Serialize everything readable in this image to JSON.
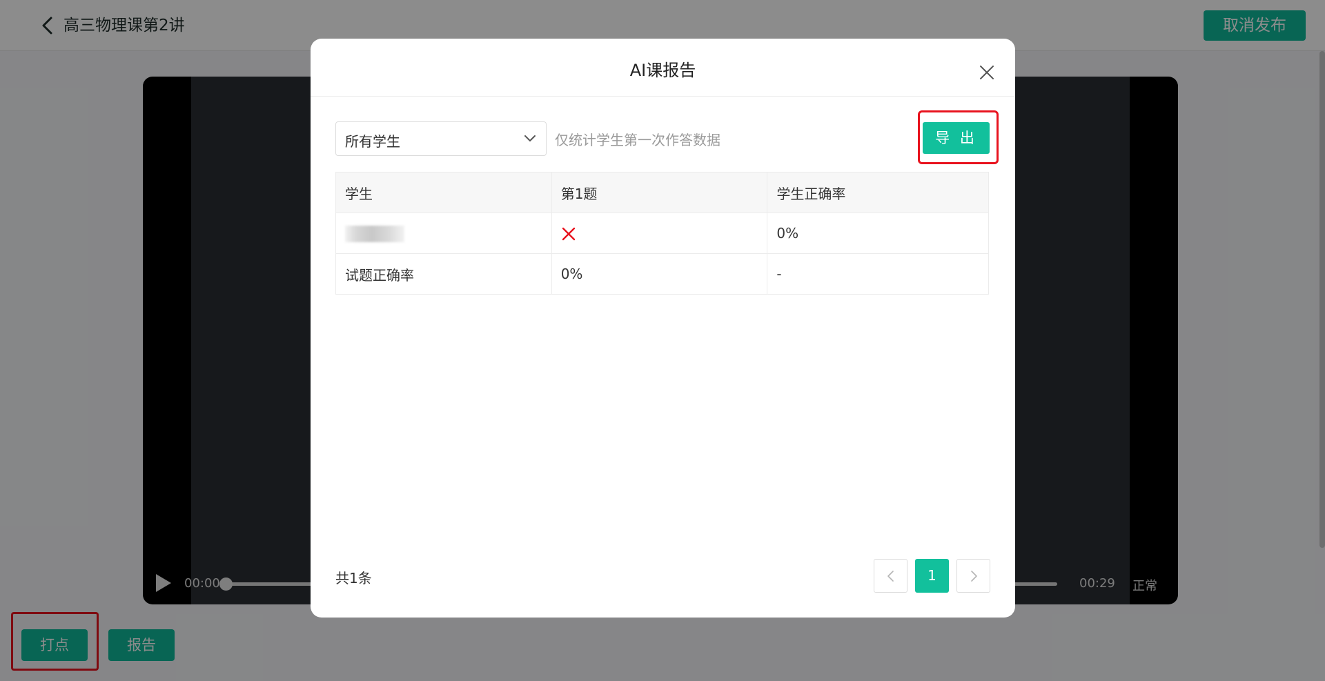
{
  "header": {
    "lesson_title": "高三物理课第2讲",
    "unpublish_label": "取消发布"
  },
  "player": {
    "time_start": "00:00",
    "time_end": "00:29",
    "speed": "正常",
    "progress_fraction": 0
  },
  "bottom_actions": {
    "dot_label": "打点",
    "report_label": "报告"
  },
  "modal": {
    "title": "AI课报告",
    "filter": {
      "selected": "所有学生",
      "hint": "仅统计学生第一次作答数据"
    },
    "export_label": "导 出",
    "table": {
      "headers": [
        "学生",
        "第1题",
        "学生正确率"
      ],
      "rows": [
        {
          "student": "",
          "q1": "wrong",
          "accuracy": "0%"
        },
        {
          "student": "试题正确率",
          "q1": "0%",
          "accuracy": "-"
        }
      ]
    },
    "footer": {
      "total": "共1条",
      "current_page": "1"
    }
  },
  "colors": {
    "accent": "#12c09c",
    "highlight": "#e8131e",
    "wrong": "#e8131e"
  },
  "icons": {
    "back": "chevron-left-icon",
    "close": "close-icon",
    "select": "chevron-down-icon",
    "wrong": "wrong-icon",
    "prev": "chevron-left-icon",
    "next": "chevron-right-icon",
    "play": "play-icon"
  }
}
